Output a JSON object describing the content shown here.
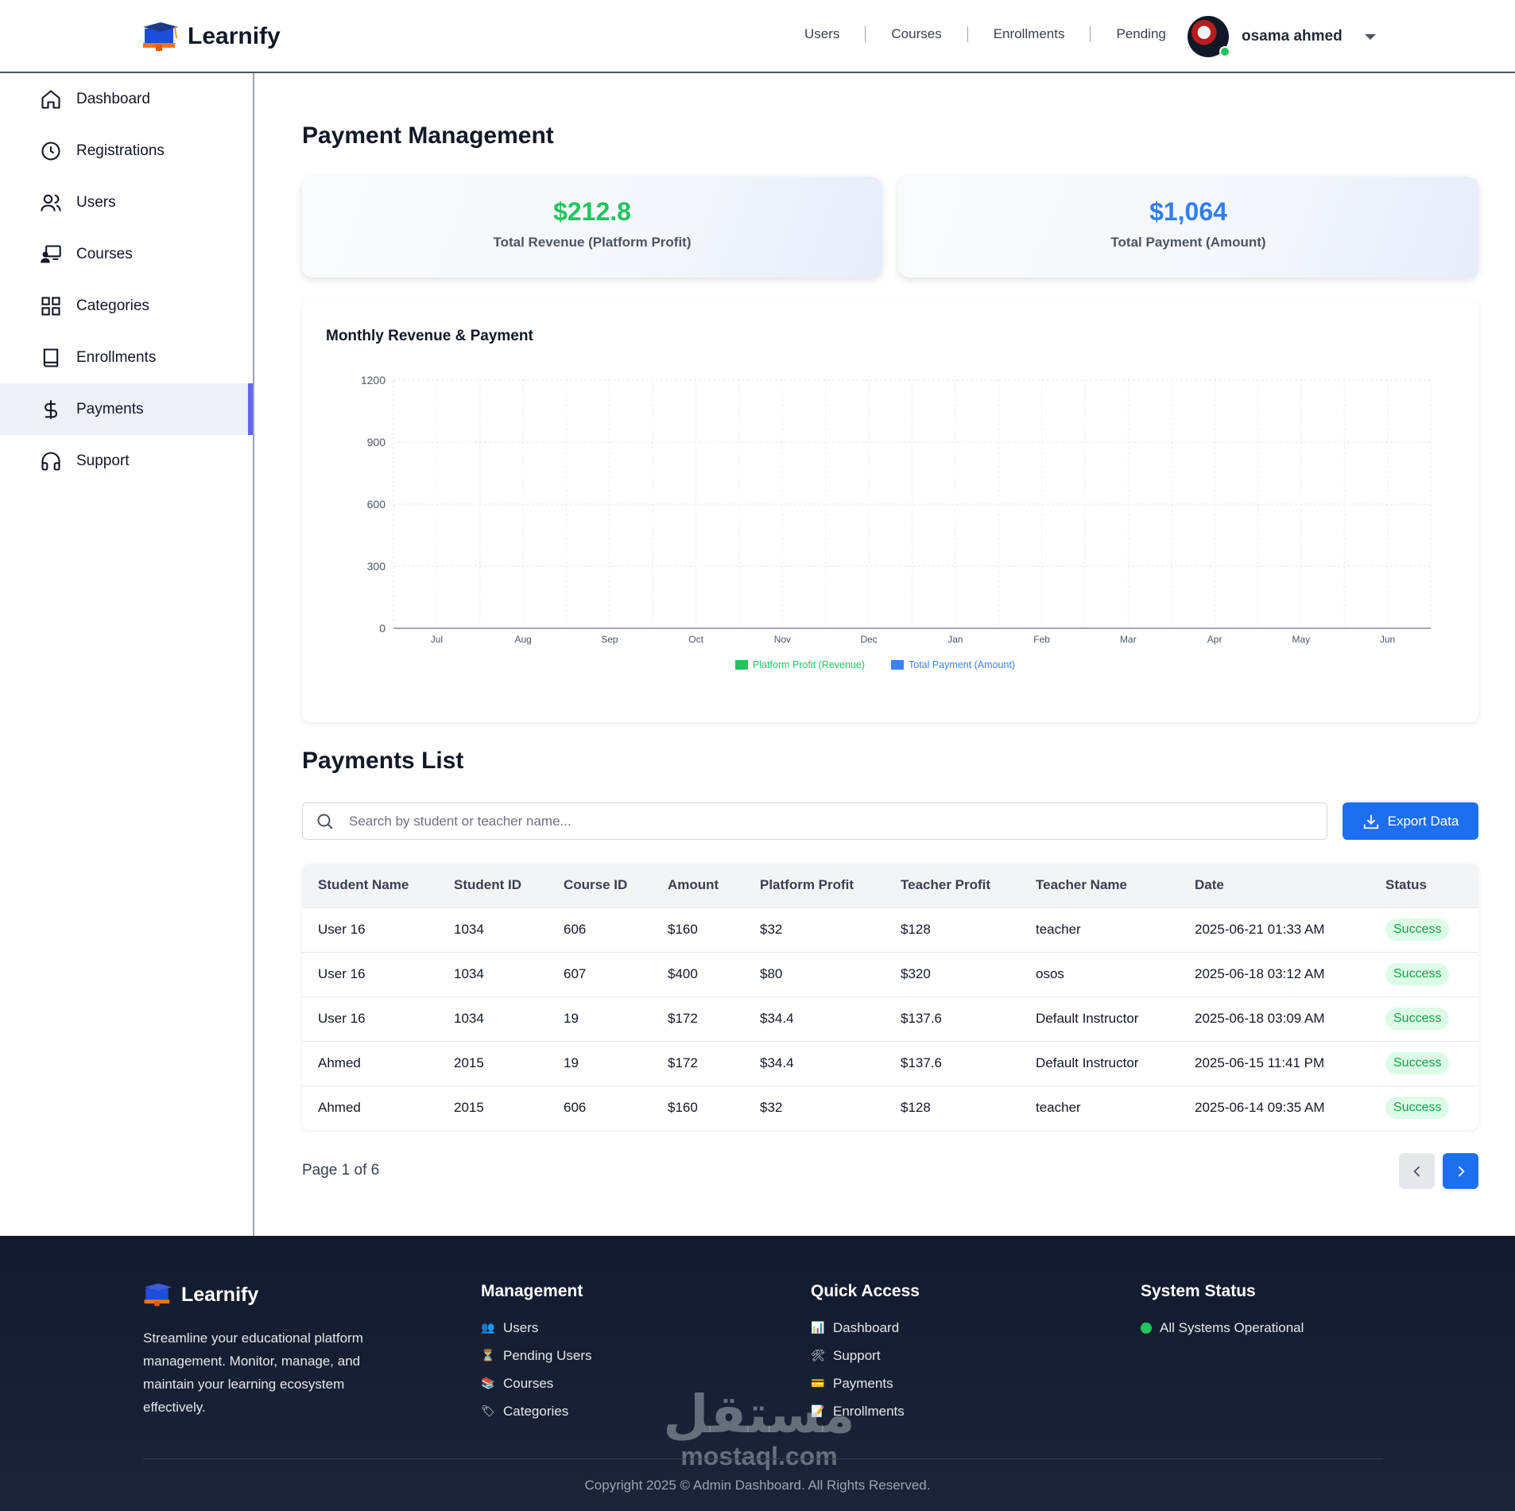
{
  "brand": {
    "name": "Learnify"
  },
  "topnav": {
    "items": [
      "Users",
      "Courses",
      "Enrollments",
      "Pending"
    ]
  },
  "profile": {
    "name": "osama ahmed"
  },
  "sidebar": {
    "items": [
      {
        "label": "Dashboard",
        "icon": "home-icon"
      },
      {
        "label": "Registrations",
        "icon": "clock-icon"
      },
      {
        "label": "Users",
        "icon": "users-icon"
      },
      {
        "label": "Courses",
        "icon": "presentation-icon"
      },
      {
        "label": "Categories",
        "icon": "grid-icon"
      },
      {
        "label": "Enrollments",
        "icon": "book-icon"
      },
      {
        "label": "Payments",
        "icon": "dollar-icon",
        "active": true
      },
      {
        "label": "Support",
        "icon": "headset-icon"
      }
    ]
  },
  "page": {
    "title": "Payment Management"
  },
  "stats": {
    "revenue": {
      "value": "$212.8",
      "label": "Total Revenue (Platform Profit)",
      "color": "#22c55e"
    },
    "payment": {
      "value": "$1,064",
      "label": "Total Payment (Amount)",
      "color": "#2f80ed"
    }
  },
  "chart_data": {
    "type": "bar",
    "title": "Monthly Revenue & Payment",
    "categories": [
      "Jul",
      "Aug",
      "Sep",
      "Oct",
      "Nov",
      "Dec",
      "Jan",
      "Feb",
      "Mar",
      "Apr",
      "May",
      "Jun"
    ],
    "series": [
      {
        "name": "Platform Profit (Revenue)",
        "color": "#22c55e",
        "values": [
          0,
          0,
          0,
          0,
          0,
          0,
          0,
          0,
          0,
          0,
          0,
          0
        ]
      },
      {
        "name": "Total Payment (Amount)",
        "color": "#3b82f6",
        "values": [
          0,
          0,
          0,
          0,
          0,
          0,
          0,
          0,
          0,
          0,
          0,
          0
        ]
      }
    ],
    "ylim": [
      0,
      1200
    ],
    "yticks": [
      0,
      300,
      600,
      900,
      1200
    ],
    "grid": true,
    "legend": "bottom-center"
  },
  "payments": {
    "title": "Payments List",
    "search_placeholder": "Search by student or teacher name...",
    "export_label": "Export Data",
    "columns": [
      "Student Name",
      "Student ID",
      "Course ID",
      "Amount",
      "Platform Profit",
      "Teacher Profit",
      "Teacher Name",
      "Date",
      "Status"
    ],
    "rows": [
      [
        "User 16",
        "1034",
        "606",
        "$160",
        "$32",
        "$128",
        "teacher",
        "2025-06-21 01:33 AM",
        "Success"
      ],
      [
        "User 16",
        "1034",
        "607",
        "$400",
        "$80",
        "$320",
        "osos",
        "2025-06-18 03:12 AM",
        "Success"
      ],
      [
        "User 16",
        "1034",
        "19",
        "$172",
        "$34.4",
        "$137.6",
        "Default Instructor",
        "2025-06-18 03:09 AM",
        "Success"
      ],
      [
        "Ahmed",
        "2015",
        "19",
        "$172",
        "$34.4",
        "$137.6",
        "Default Instructor",
        "2025-06-15 11:41 PM",
        "Success"
      ],
      [
        "Ahmed",
        "2015",
        "606",
        "$160",
        "$32",
        "$128",
        "teacher",
        "2025-06-14 09:35 AM",
        "Success"
      ]
    ],
    "page_info": "Page 1 of 6"
  },
  "footer": {
    "brand": "Learnify",
    "description": "Streamline your educational platform management. Monitor, manage, and maintain your learning ecosystem effectively.",
    "management": {
      "title": "Management",
      "links": [
        "Users",
        "Pending Users",
        "Courses",
        "Categories"
      ]
    },
    "quick_access": {
      "title": "Quick Access",
      "links": [
        "Dashboard",
        "Support",
        "Payments",
        "Enrollments"
      ]
    },
    "system_status": {
      "title": "System Status",
      "text": "All Systems Operational"
    },
    "copyright": "Copyright 2025 © Admin Dashboard. All Rights Reserved.",
    "watermark": {
      "arabic": "مستقل",
      "latin": "mostaql.com"
    }
  }
}
